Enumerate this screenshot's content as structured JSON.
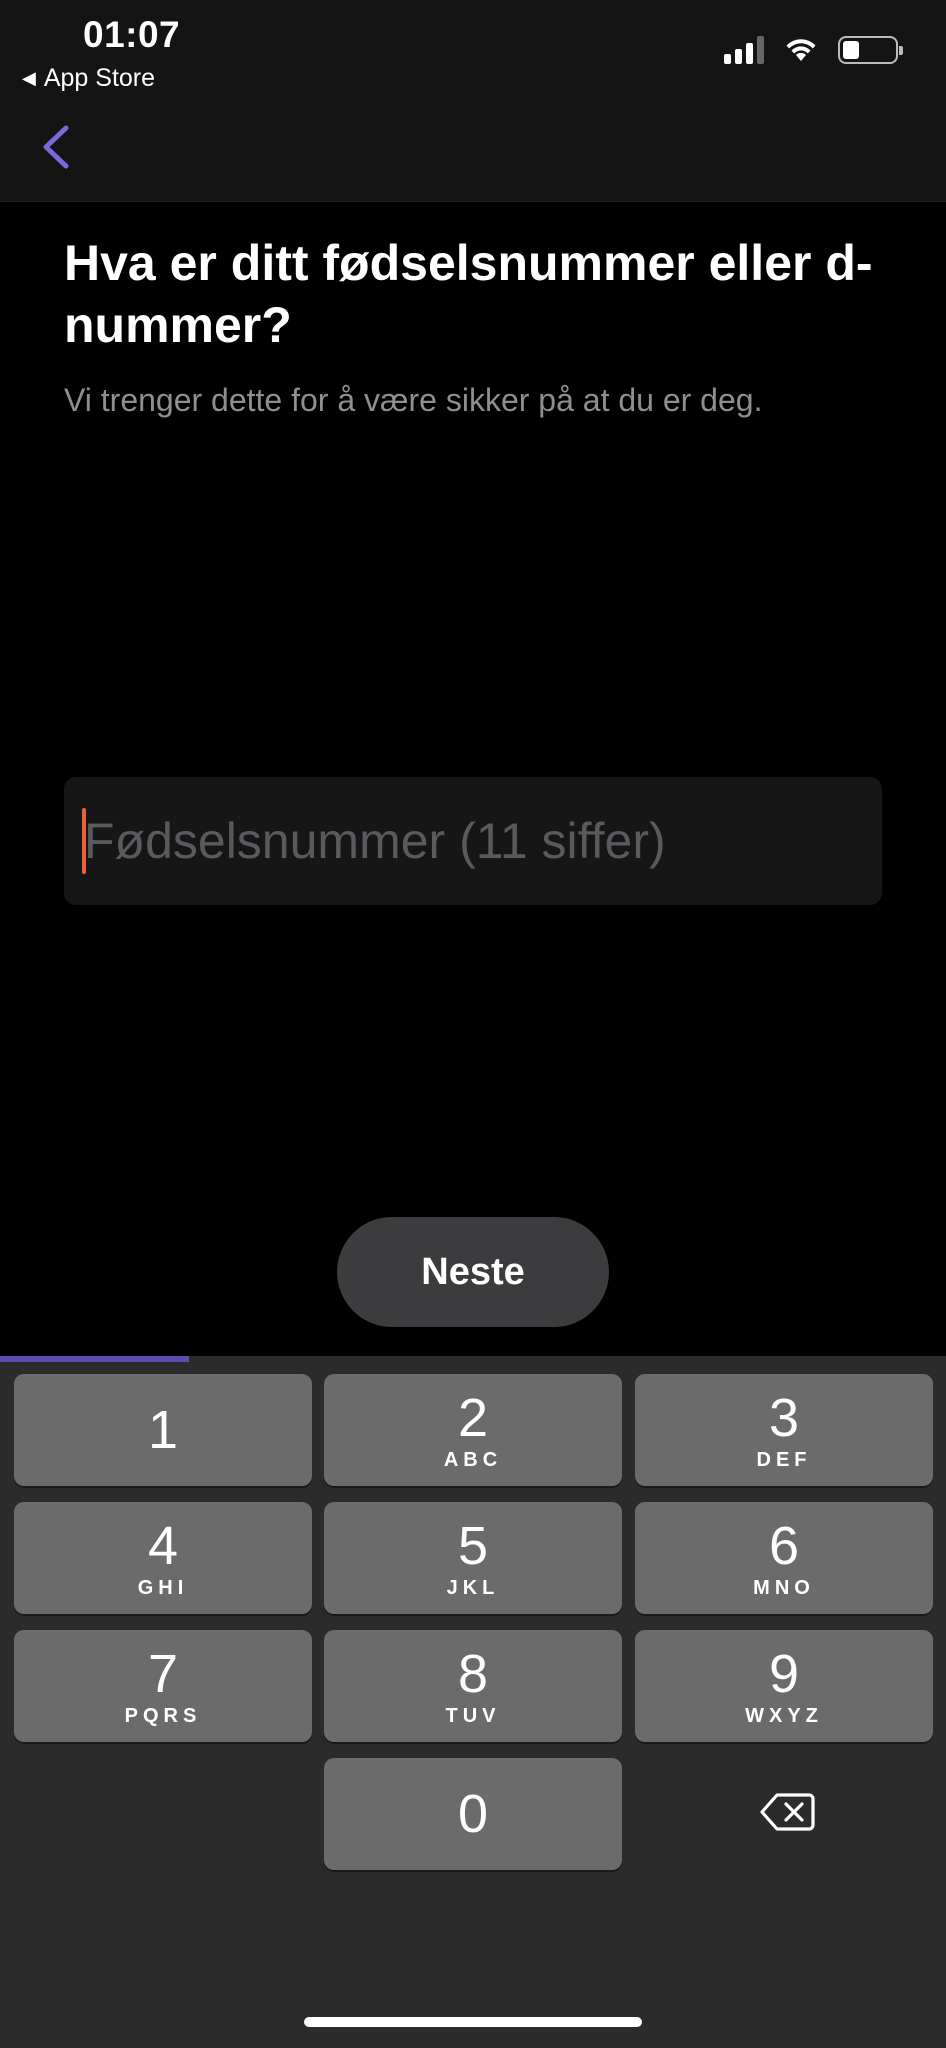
{
  "status_bar": {
    "time": "01:07",
    "back_app_label": "App Store",
    "back_app_arrow": "◀"
  },
  "nav": {
    "back_icon": "chevron-left-icon",
    "accent_color": "#7b68d9"
  },
  "main": {
    "title": "Hva er ditt fødselsnummer eller d-nummer?",
    "subtitle": "Vi trenger dette for å være sikker på at du er deg.",
    "input": {
      "placeholder": "Fødselsnummer (11 siffer)",
      "value": ""
    },
    "next_button_label": "Neste",
    "progress": 0.2
  },
  "keypad": {
    "keys": [
      {
        "digit": "1",
        "letters": ""
      },
      {
        "digit": "2",
        "letters": "ABC"
      },
      {
        "digit": "3",
        "letters": "DEF"
      },
      {
        "digit": "4",
        "letters": "GHI"
      },
      {
        "digit": "5",
        "letters": "JKL"
      },
      {
        "digit": "6",
        "letters": "MNO"
      },
      {
        "digit": "7",
        "letters": "PQRS"
      },
      {
        "digit": "8",
        "letters": "TUV"
      },
      {
        "digit": "9",
        "letters": "WXYZ"
      },
      {
        "digit": "0",
        "letters": ""
      }
    ],
    "delete_icon": "backspace-icon"
  }
}
